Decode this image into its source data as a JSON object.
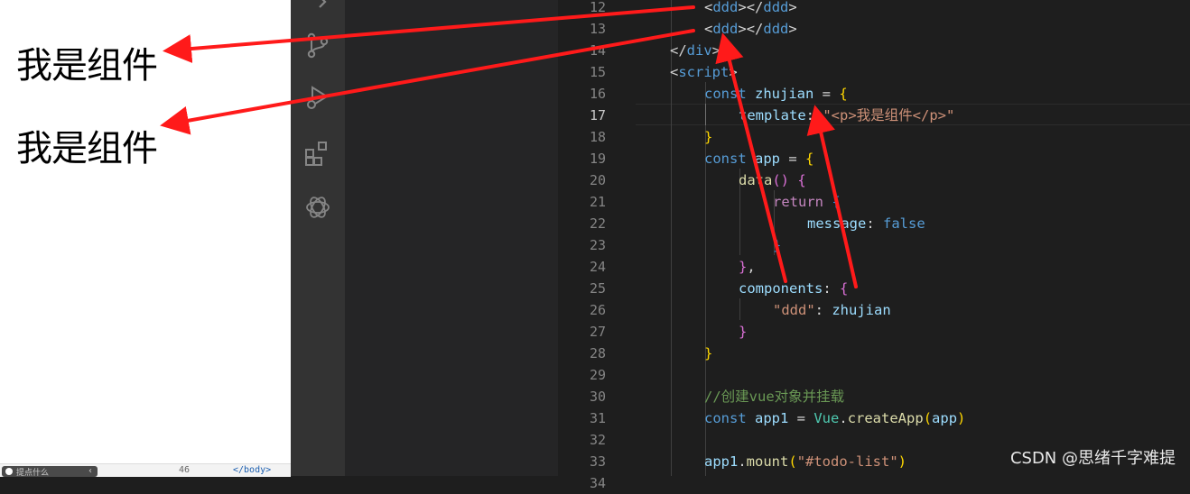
{
  "browser": {
    "component_text_1": "我是组件",
    "component_text_2": "我是组件",
    "bottom_bar": {
      "pill_text": "提点什么",
      "line_number": "46",
      "body_tag": "</body>"
    }
  },
  "activity_bar": {
    "icons": [
      "search-icon",
      "source-control-icon",
      "run-debug-icon",
      "extensions-icon",
      "openai-icon"
    ]
  },
  "editor": {
    "active_line": 17,
    "lines": [
      {
        "n": "12",
        "text": "<ddd></ddd>"
      },
      {
        "n": "13",
        "text": "<ddd></ddd>"
      },
      {
        "n": "14",
        "text": "</div>"
      },
      {
        "n": "15",
        "text": "<script>"
      },
      {
        "n": "16",
        "text": "const zhujian = {"
      },
      {
        "n": "17",
        "text": "template: \"<p>我是组件</p>\""
      },
      {
        "n": "18",
        "text": "}"
      },
      {
        "n": "19",
        "text": "const app = {"
      },
      {
        "n": "20",
        "text": "data() {"
      },
      {
        "n": "21",
        "text": "return {"
      },
      {
        "n": "22",
        "text": "message: false"
      },
      {
        "n": "23",
        "text": "}"
      },
      {
        "n": "24",
        "text": "},"
      },
      {
        "n": "25",
        "text": "components: {"
      },
      {
        "n": "26",
        "text": "\"ddd\": zhujian"
      },
      {
        "n": "27",
        "text": "}"
      },
      {
        "n": "28",
        "text": "}"
      },
      {
        "n": "29",
        "text": ""
      },
      {
        "n": "30",
        "text": "//创建vue对象并挂载"
      },
      {
        "n": "31",
        "text": "const app1 = Vue.createApp(app)"
      },
      {
        "n": "32",
        "text": ""
      },
      {
        "n": "33",
        "text": "app1.mount(\"#todo-list\")"
      },
      {
        "n": "34",
        "text": ""
      }
    ]
  },
  "watermark": "CSDN @思绪千字难提",
  "colors": {
    "arrow": "#ff1a1a",
    "editor_bg": "#1e1e1e",
    "activity_bg": "#333333"
  }
}
